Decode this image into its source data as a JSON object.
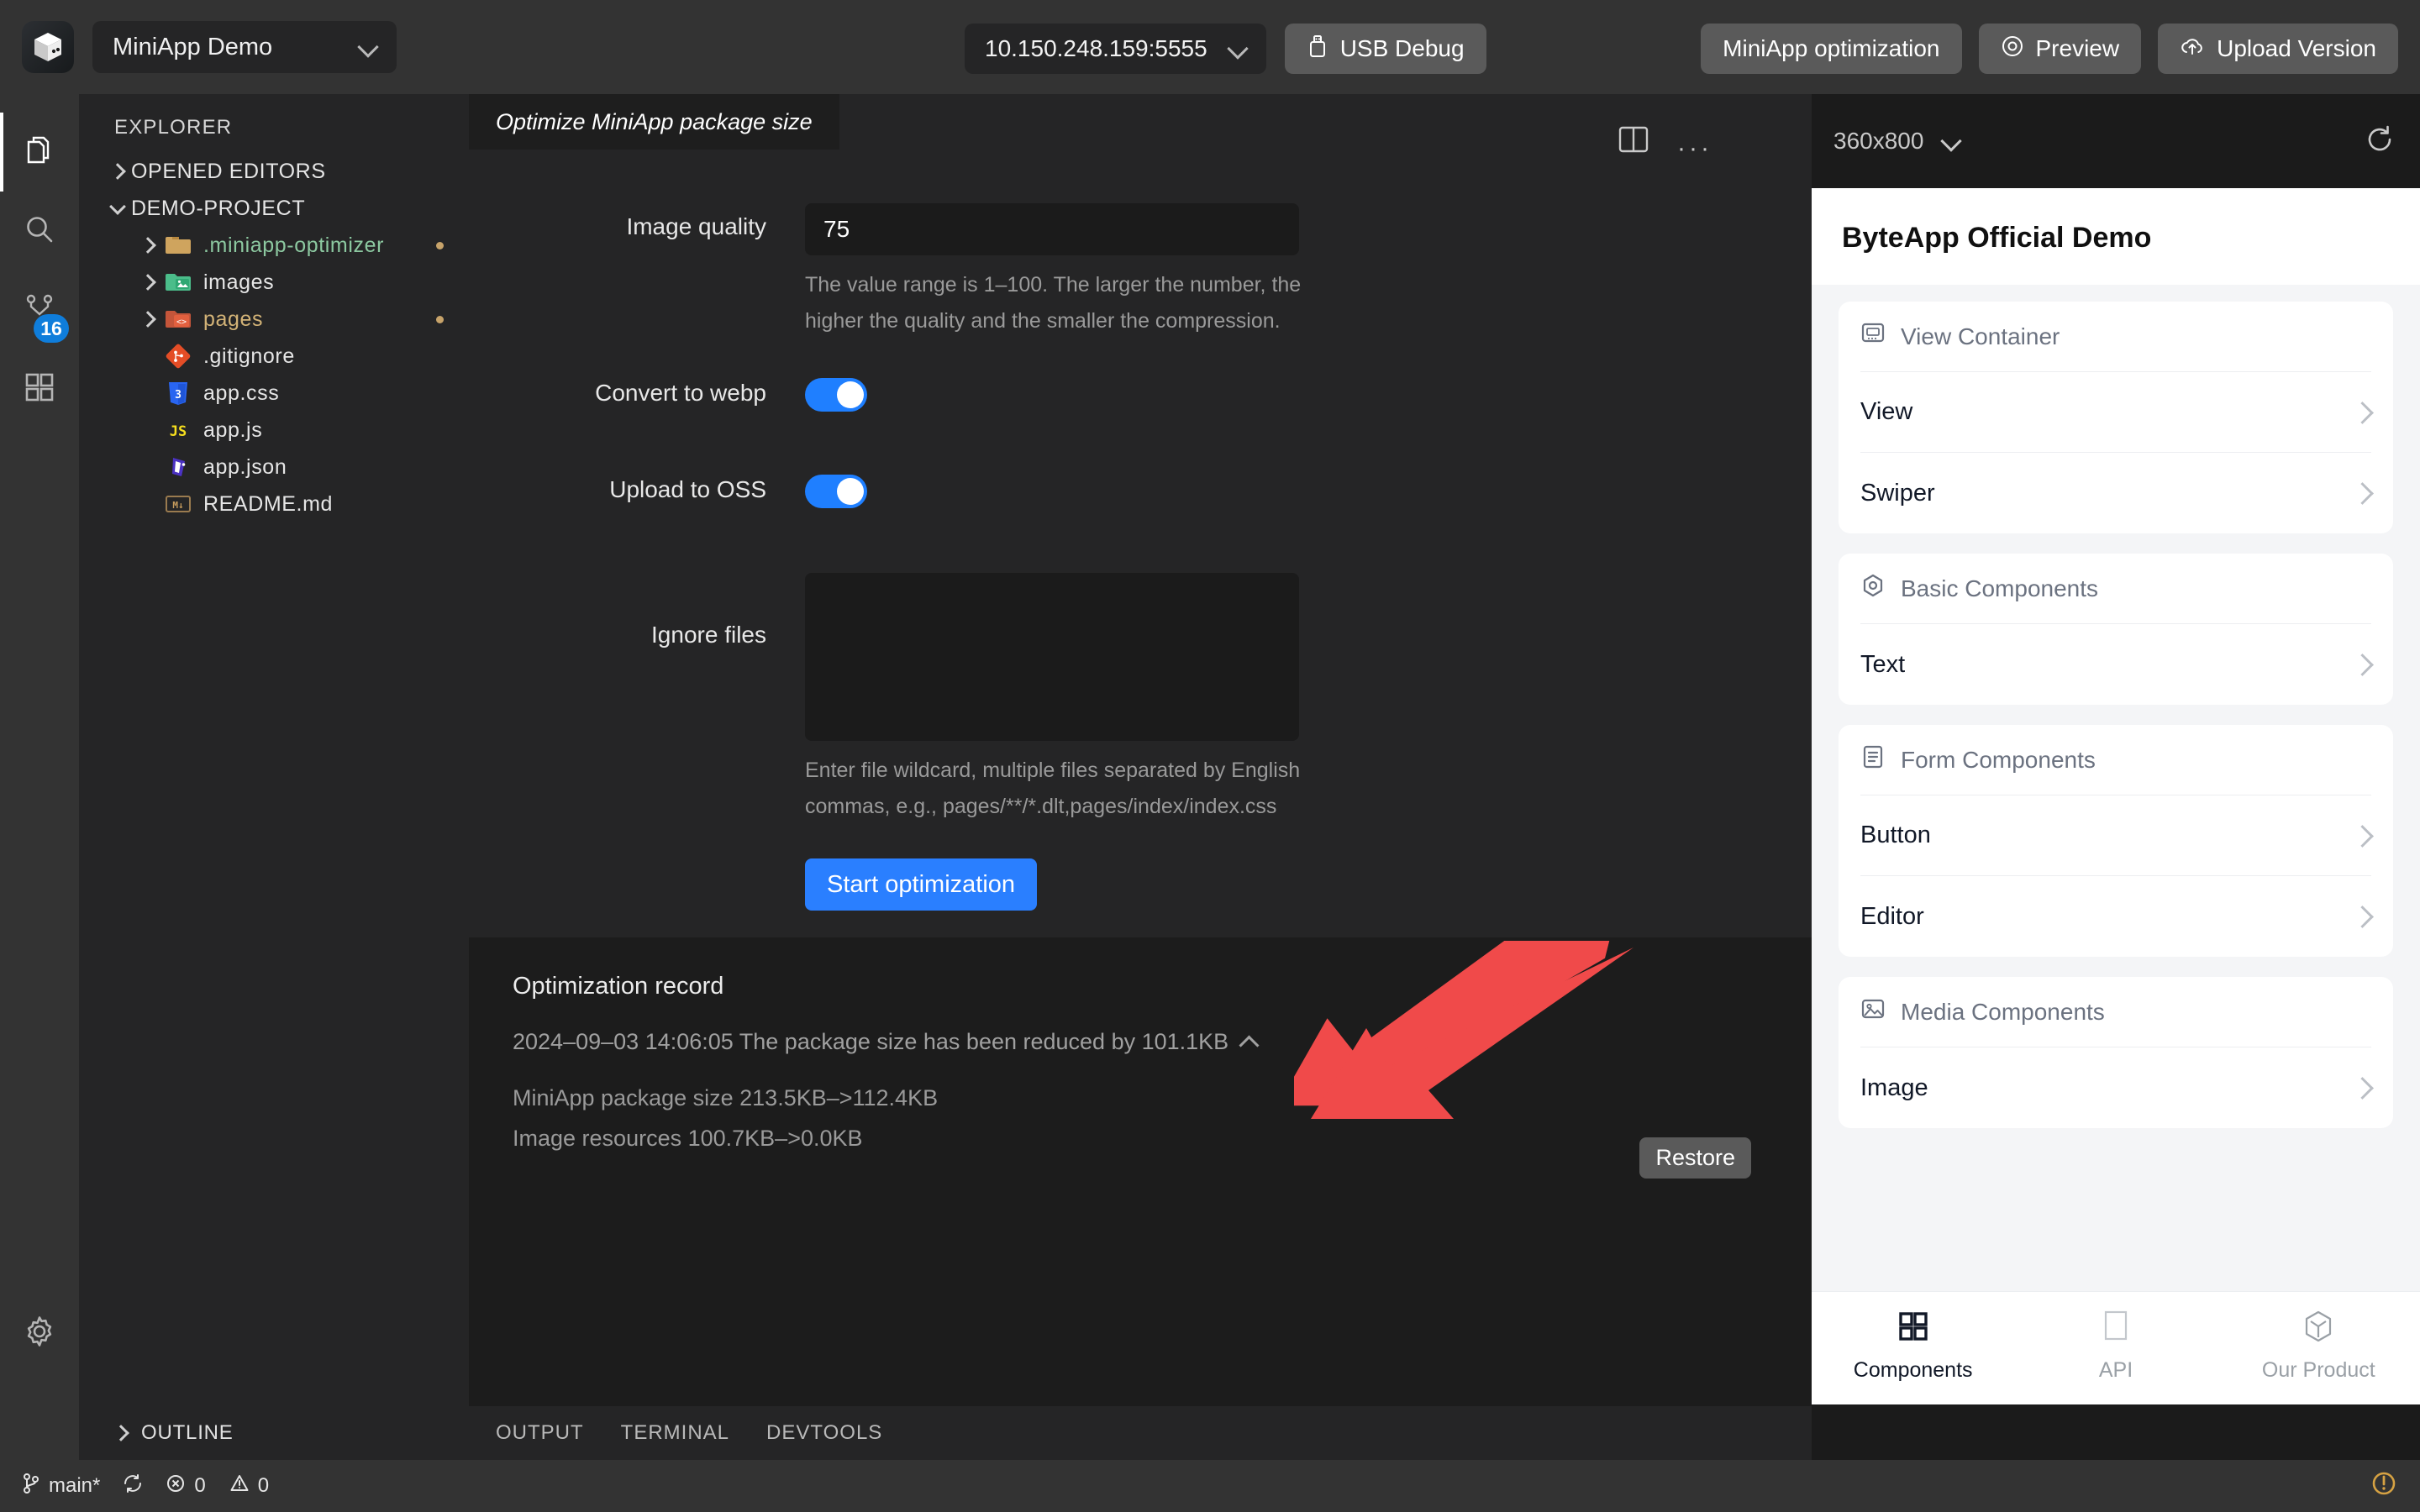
{
  "titlebar": {
    "logo_icon": "cube-logo-icon",
    "project_name": "MiniApp Demo",
    "project_dropdown_icon": "chevron-down-icon",
    "device_address": "10.150.248.159:5555",
    "device_dropdown_icon": "chevron-down-icon",
    "usb_debug_label": "USB Debug",
    "usb_icon": "usb-icon",
    "miniapp_optimization_label": "MiniApp optimization",
    "preview_label": "Preview",
    "preview_icon": "eye-target-icon",
    "upload_label": "Upload Version",
    "upload_icon": "cloud-upload-icon"
  },
  "activitybar": {
    "items": [
      {
        "name": "explorer-icon",
        "label": "Explorer",
        "active": true,
        "badge": ""
      },
      {
        "name": "search-icon",
        "label": "Search",
        "active": false,
        "badge": ""
      },
      {
        "name": "source-control-icon",
        "label": "Source Control",
        "active": false,
        "badge": "16"
      },
      {
        "name": "extensions-icon",
        "label": "Extensions",
        "active": false,
        "badge": ""
      }
    ],
    "settings_icon": "gear-icon"
  },
  "explorer": {
    "title": "EXPLORER",
    "sections": [
      {
        "label": "OPENED EDITORS",
        "expanded": false
      },
      {
        "label": "DEMO-PROJECT",
        "expanded": true
      }
    ],
    "files": [
      {
        "label": ".miniapp-optimizer",
        "type": "folder",
        "icon": "folder-icon",
        "color": "#8cc8a0",
        "icon_color": "#d8a657",
        "indent": 2,
        "expandable": true,
        "modified_dot": "#c7a36a"
      },
      {
        "label": "images",
        "type": "folder",
        "icon": "folder-images-icon",
        "color": "#e2e2e2",
        "icon_color": "#5ec99a",
        "indent": 2,
        "expandable": true,
        "modified_dot": ""
      },
      {
        "label": "pages",
        "type": "folder",
        "icon": "folder-code-icon",
        "color": "#d3b377",
        "icon_color": "#c4553a",
        "indent": 2,
        "expandable": true,
        "modified_dot": "#c7a36a"
      },
      {
        "label": ".gitignore",
        "type": "file",
        "icon": "git-icon",
        "color": "#e2e2e2",
        "icon_color": "#e44d26",
        "indent": 3,
        "expandable": false,
        "modified_dot": ""
      },
      {
        "label": "app.css",
        "type": "file",
        "icon": "css-icon",
        "color": "#e2e2e2",
        "icon_color": "#2965f1",
        "indent": 3,
        "expandable": false,
        "modified_dot": ""
      },
      {
        "label": "app.js",
        "type": "file",
        "icon": "js-icon",
        "color": "#e2e2e2",
        "icon_color": "#f7df1e",
        "indent": 3,
        "expandable": false,
        "modified_dot": ""
      },
      {
        "label": "app.json",
        "type": "file",
        "icon": "json-icon",
        "color": "#e2e2e2",
        "icon_color": "#4b32c3",
        "indent": 3,
        "expandable": false,
        "modified_dot": ""
      },
      {
        "label": "README.md",
        "type": "file",
        "icon": "markdown-icon",
        "color": "#e2e2e2",
        "icon_color": "#9a7b4f",
        "indent": 3,
        "expandable": false,
        "modified_dot": ""
      }
    ],
    "outline_label": "OUTLINE"
  },
  "editor": {
    "tab_label": "Optimize MiniApp package size",
    "form": {
      "image_quality_label": "Image quality",
      "image_quality_value": "75",
      "image_quality_hint": "The value range is 1–100. The larger the number, the higher the quality and the smaller the compression.",
      "convert_webp_label": "Convert to webp",
      "convert_webp_on": true,
      "upload_oss_label": "Upload to OSS",
      "upload_oss_on": true,
      "ignore_files_label": "Ignore files",
      "ignore_files_value": "",
      "ignore_files_hint": "Enter file wildcard, multiple files separated by English commas, e.g., pages/**/*.dlt,pages/index/index.css",
      "start_button_label": "Start optimization"
    },
    "record": {
      "title": "Optimization record",
      "entry_line": "2024–09–03 14:06:05 The package size has been reduced by 101.1KB",
      "collapse_icon": "chevron-up-icon",
      "detail_line_1": "MiniApp package size 213.5KB–>112.4KB",
      "detail_line_2": "Image resources 100.7KB–>0.0KB",
      "restore_button_label": "Restore"
    },
    "panel_tabs": [
      "OUTPUT",
      "TERMINAL",
      "DEVTOOLS"
    ]
  },
  "annotation": {
    "arrow_color": "#f04a4a",
    "arrow_name": "red-pointer-arrow"
  },
  "simulator": {
    "split_icon": "split-panel-icon",
    "more_icon": "ellipsis-icon",
    "resolution": "360x800",
    "resolution_dropdown_icon": "chevron-down-icon",
    "refresh_icon": "refresh-icon",
    "phone_title": "ByteApp Official Demo",
    "cards": [
      {
        "header": "View Container",
        "header_icon": "view-container-icon",
        "items": [
          "View",
          "Swiper"
        ]
      },
      {
        "header": "Basic Components",
        "header_icon": "basic-components-icon",
        "items": [
          "Text"
        ]
      },
      {
        "header": "Form Components",
        "header_icon": "form-components-icon",
        "items": [
          "Button",
          "Editor"
        ]
      },
      {
        "header": "Media Components",
        "header_icon": "media-components-icon",
        "items": [
          "Image"
        ]
      }
    ],
    "tabbar": [
      {
        "label": "Components",
        "icon": "grid-icon",
        "active": true
      },
      {
        "label": "API",
        "icon": "page-icon",
        "active": false
      },
      {
        "label": "Our Product",
        "icon": "hexagon-icon",
        "active": false
      }
    ]
  },
  "statusbar": {
    "branch_icon": "source-control-branch-icon",
    "branch": "main*",
    "sync_icon": "sync-icon",
    "error_icon": "error-circle-icon",
    "errors": "0",
    "warning_icon": "warning-triangle-icon",
    "warnings": "0",
    "notification_icon": "warning-bell-icon"
  },
  "colors": {
    "accent_blue": "#2a7fff",
    "toggle_on": "#1f7fff",
    "badge_blue": "#0f7ddb",
    "annotation_red": "#f04a4a",
    "status_warning": "#d6a243"
  }
}
